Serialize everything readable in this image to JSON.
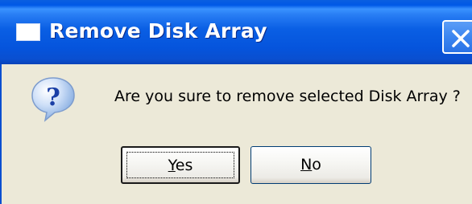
{
  "dialog": {
    "title": "Remove Disk Array",
    "message": "Are you sure to remove selected Disk Array ?",
    "icon": "question-icon",
    "buttons": {
      "yes": {
        "accel": "Y",
        "rest": "es"
      },
      "no": {
        "accel": "N",
        "rest": "o"
      }
    }
  },
  "colors": {
    "titlebar": "#0058e6",
    "face": "#ece9d8",
    "button_border": "#003c74"
  }
}
